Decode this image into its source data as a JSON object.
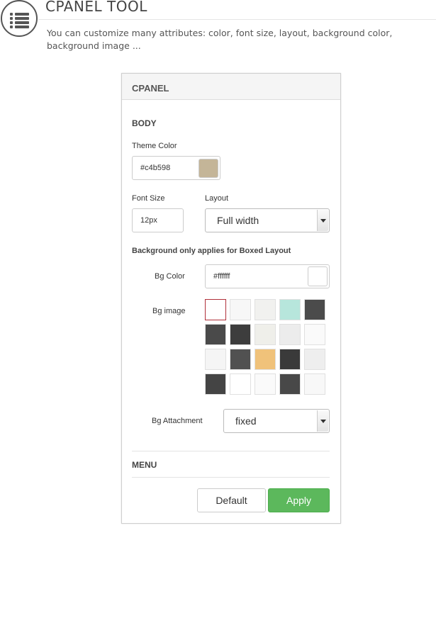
{
  "header": {
    "title": "CPANEL TOOL",
    "description": "You can customize many attributes: color, font size, layout, background color, background image ...",
    "icon": "list-icon"
  },
  "panel": {
    "title": "CPANEL",
    "body_section": "BODY",
    "theme_color": {
      "label": "Theme Color",
      "value": "#c4b598",
      "swatch_color": "#c4b598"
    },
    "font_size": {
      "label": "Font Size",
      "value": "12px"
    },
    "layout": {
      "label": "Layout",
      "selected": "Full width"
    },
    "bg_note": "Background only applies for Boxed Layout",
    "bg_color": {
      "label": "Bg Color",
      "value": "#ffffff",
      "swatch_color": "#ffffff"
    },
    "bg_image": {
      "label": "Bg image",
      "thumbs": [
        {
          "color": "#ffffff",
          "selected": true
        },
        {
          "color": "#f7f7f7"
        },
        {
          "color": "#f1f1ef"
        },
        {
          "color": "#b7e6dc"
        },
        {
          "color": "#4b4b4b"
        },
        {
          "color": "#4a4a4a"
        },
        {
          "color": "#3d3d3d"
        },
        {
          "color": "#efefea"
        },
        {
          "color": "#ececec"
        },
        {
          "color": "#fafafa"
        },
        {
          "color": "#f5f5f5"
        },
        {
          "color": "#515151"
        },
        {
          "color": "#f0c27a"
        },
        {
          "color": "#3a3a3a"
        },
        {
          "color": "#eeeeee"
        },
        {
          "color": "#444444"
        },
        {
          "color": "#ffffff"
        },
        {
          "color": "#fafafa"
        },
        {
          "color": "#484848"
        },
        {
          "color": "#f8f8f8"
        }
      ]
    },
    "bg_attachment": {
      "label": "Bg Attachment",
      "selected": "fixed"
    },
    "menu_section": "MENU",
    "buttons": {
      "default_label": "Default",
      "apply_label": "Apply"
    }
  }
}
